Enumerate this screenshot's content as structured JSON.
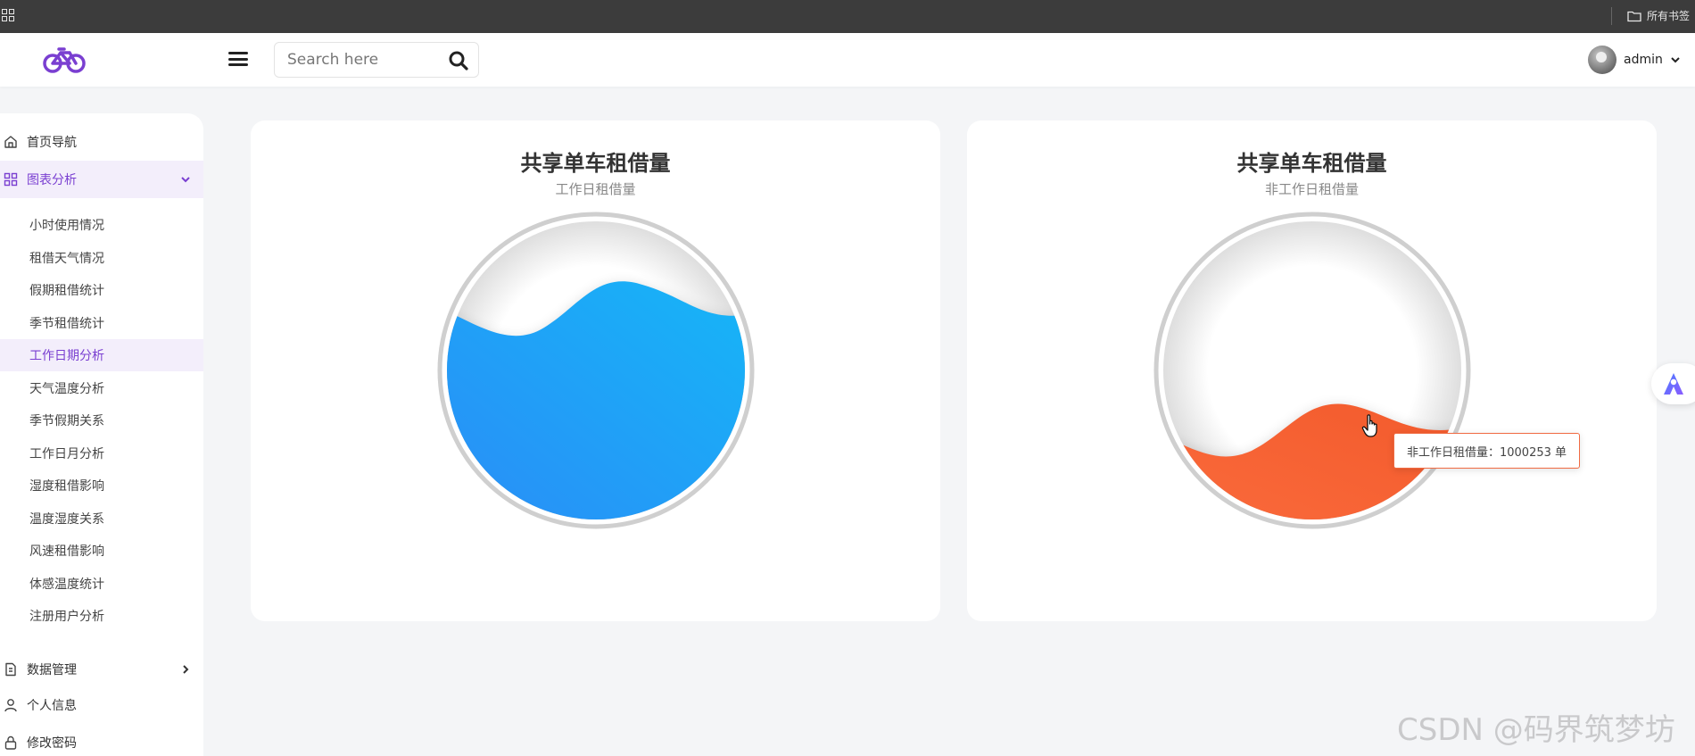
{
  "browser": {
    "bookmarks_label": "所有书签",
    "apps_icon": "apps-grid-icon",
    "folder_icon": "folder-icon"
  },
  "header": {
    "logo_icon": "bicycle-icon",
    "menu_icon": "hamburger-icon",
    "search": {
      "placeholder": "Search here",
      "value": ""
    },
    "search_icon": "search-icon",
    "user": {
      "name": "admin"
    }
  },
  "sidebar": {
    "items": [
      {
        "label": "首页导航",
        "icon": "home-icon",
        "active": false
      },
      {
        "label": "图表分析",
        "icon": "grid-icon",
        "active": true,
        "expanded": true
      },
      {
        "label": "数据管理",
        "icon": "document-icon",
        "active": false
      },
      {
        "label": "个人信息",
        "icon": "user-icon",
        "active": false
      },
      {
        "label": "修改密码",
        "icon": "lock-icon",
        "active": false
      }
    ],
    "submenu": [
      {
        "label": "小时使用情况"
      },
      {
        "label": "租借天气情况"
      },
      {
        "label": "假期租借统计"
      },
      {
        "label": "季节租借统计"
      },
      {
        "label": "工作日期分析",
        "active": true
      },
      {
        "label": "天气温度分析"
      },
      {
        "label": "季节假期关系"
      },
      {
        "label": "工作日月分析"
      },
      {
        "label": "湿度租借影响"
      },
      {
        "label": "温度湿度关系"
      },
      {
        "label": "风速租借影响"
      },
      {
        "label": "体感温度统计"
      },
      {
        "label": "注册用户分析"
      }
    ]
  },
  "cards": [
    {
      "title": "共享单车租借量",
      "subtitle": "工作日租借量",
      "color_start": "#2a8cf7",
      "color_end": "#16b6f7"
    },
    {
      "title": "共享单车租借量",
      "subtitle": "非工作日租借量",
      "color_start": "#fb6b3c",
      "color_end": "#f25a2c"
    }
  ],
  "tooltip": {
    "text": "非工作日租借量：1000253 单"
  },
  "watermark": "CSDN @码界筑梦坊",
  "colors": {
    "accent": "#7a3fd1",
    "liquid_blue": "#1aa6f8",
    "liquid_orange": "#f7602f"
  }
}
